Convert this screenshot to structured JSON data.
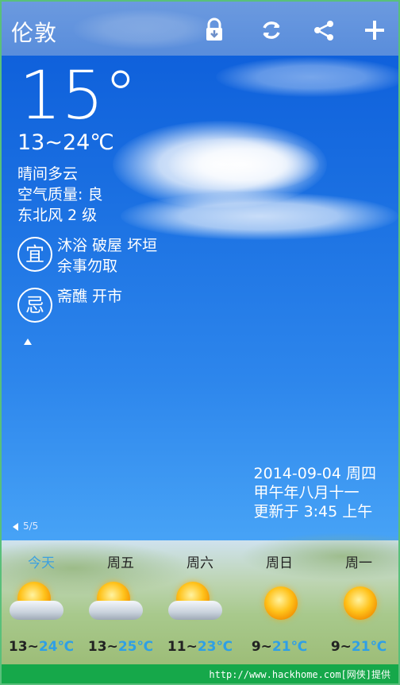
{
  "header": {
    "city": "伦敦",
    "icons": [
      "lock-download-icon",
      "refresh-icon",
      "share-icon",
      "add-icon"
    ]
  },
  "current": {
    "temp": "15°",
    "range": "13~24℃",
    "condition": "晴间多云",
    "air_quality": "空气质量: 良",
    "wind": "东北风 2 级"
  },
  "almanac": {
    "good_badge": "宜",
    "good_line1": "沐浴  破屋  坏垣",
    "good_line2": "余事勿取",
    "bad_badge": "忌",
    "bad_line1": "斋醮  开市"
  },
  "date_info": {
    "date": "2014-09-04 周四",
    "lunar": "甲午年八月十一",
    "updated": "更新于 3:45 上午"
  },
  "pager": "5/5",
  "forecast": [
    {
      "label": "今天",
      "lo": "13~",
      "hi": "24℃",
      "icon": "partly-cloudy-icon"
    },
    {
      "label": "周五",
      "lo": "13~",
      "hi": "25℃",
      "icon": "partly-cloudy-icon"
    },
    {
      "label": "周六",
      "lo": "11~",
      "hi": "23℃",
      "icon": "partly-cloudy-icon"
    },
    {
      "label": "周日",
      "lo": "9~",
      "hi": "21℃",
      "icon": "sunny-icon"
    },
    {
      "label": "周一",
      "lo": "9~",
      "hi": "21℃",
      "icon": "sunny-icon"
    }
  ],
  "footer": "http://www.hackhome.com[网侠]提供",
  "colors": {
    "sky_top": "#0b5bd9",
    "accent": "#2e9fe6",
    "footer_bg": "#16a84a"
  }
}
